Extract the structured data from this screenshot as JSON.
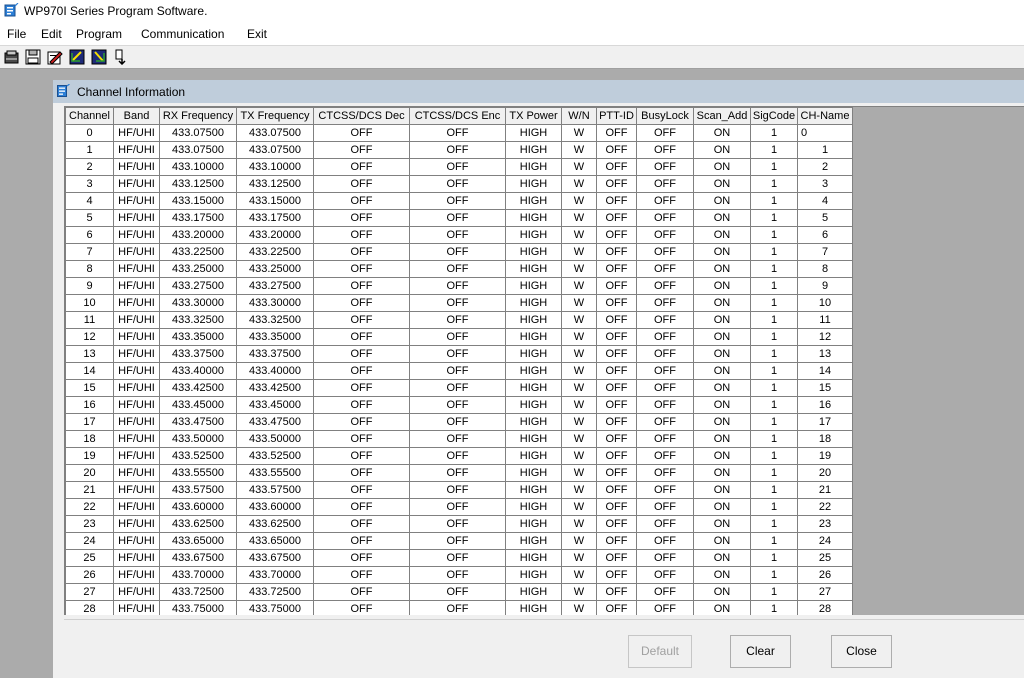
{
  "app": {
    "title": "WP970I Series Program Software."
  },
  "menu": [
    "File",
    "Edit",
    "Program",
    "Communication",
    "Exit"
  ],
  "toolbar": {
    "icons": [
      "open-icon",
      "save-icon",
      "edit-icon",
      "read-from-radio-icon",
      "write-to-radio-icon",
      "exit-icon"
    ]
  },
  "channel_window": {
    "title": "Channel Information",
    "columns": [
      "Channel",
      "Band",
      "RX Frequency",
      "TX Frequency",
      "CTCSS/DCS Dec",
      "CTCSS/DCS Enc",
      "TX Power",
      "W/N",
      "PTT-ID",
      "BusyLock",
      "Scan_Add",
      "SigCode",
      "CH-Name"
    ],
    "rows": [
      [
        "0",
        "HF/UHI",
        "433.07500",
        "433.07500",
        "OFF",
        "OFF",
        "HIGH",
        "W",
        "OFF",
        "OFF",
        "ON",
        "1",
        "0"
      ],
      [
        "1",
        "HF/UHI",
        "433.07500",
        "433.07500",
        "OFF",
        "OFF",
        "HIGH",
        "W",
        "OFF",
        "OFF",
        "ON",
        "1",
        "1"
      ],
      [
        "2",
        "HF/UHI",
        "433.10000",
        "433.10000",
        "OFF",
        "OFF",
        "HIGH",
        "W",
        "OFF",
        "OFF",
        "ON",
        "1",
        "2"
      ],
      [
        "3",
        "HF/UHI",
        "433.12500",
        "433.12500",
        "OFF",
        "OFF",
        "HIGH",
        "W",
        "OFF",
        "OFF",
        "ON",
        "1",
        "3"
      ],
      [
        "4",
        "HF/UHI",
        "433.15000",
        "433.15000",
        "OFF",
        "OFF",
        "HIGH",
        "W",
        "OFF",
        "OFF",
        "ON",
        "1",
        "4"
      ],
      [
        "5",
        "HF/UHI",
        "433.17500",
        "433.17500",
        "OFF",
        "OFF",
        "HIGH",
        "W",
        "OFF",
        "OFF",
        "ON",
        "1",
        "5"
      ],
      [
        "6",
        "HF/UHI",
        "433.20000",
        "433.20000",
        "OFF",
        "OFF",
        "HIGH",
        "W",
        "OFF",
        "OFF",
        "ON",
        "1",
        "6"
      ],
      [
        "7",
        "HF/UHI",
        "433.22500",
        "433.22500",
        "OFF",
        "OFF",
        "HIGH",
        "W",
        "OFF",
        "OFF",
        "ON",
        "1",
        "7"
      ],
      [
        "8",
        "HF/UHI",
        "433.25000",
        "433.25000",
        "OFF",
        "OFF",
        "HIGH",
        "W",
        "OFF",
        "OFF",
        "ON",
        "1",
        "8"
      ],
      [
        "9",
        "HF/UHI",
        "433.27500",
        "433.27500",
        "OFF",
        "OFF",
        "HIGH",
        "W",
        "OFF",
        "OFF",
        "ON",
        "1",
        "9"
      ],
      [
        "10",
        "HF/UHI",
        "433.30000",
        "433.30000",
        "OFF",
        "OFF",
        "HIGH",
        "W",
        "OFF",
        "OFF",
        "ON",
        "1",
        "10"
      ],
      [
        "11",
        "HF/UHI",
        "433.32500",
        "433.32500",
        "OFF",
        "OFF",
        "HIGH",
        "W",
        "OFF",
        "OFF",
        "ON",
        "1",
        "11"
      ],
      [
        "12",
        "HF/UHI",
        "433.35000",
        "433.35000",
        "OFF",
        "OFF",
        "HIGH",
        "W",
        "OFF",
        "OFF",
        "ON",
        "1",
        "12"
      ],
      [
        "13",
        "HF/UHI",
        "433.37500",
        "433.37500",
        "OFF",
        "OFF",
        "HIGH",
        "W",
        "OFF",
        "OFF",
        "ON",
        "1",
        "13"
      ],
      [
        "14",
        "HF/UHI",
        "433.40000",
        "433.40000",
        "OFF",
        "OFF",
        "HIGH",
        "W",
        "OFF",
        "OFF",
        "ON",
        "1",
        "14"
      ],
      [
        "15",
        "HF/UHI",
        "433.42500",
        "433.42500",
        "OFF",
        "OFF",
        "HIGH",
        "W",
        "OFF",
        "OFF",
        "ON",
        "1",
        "15"
      ],
      [
        "16",
        "HF/UHI",
        "433.45000",
        "433.45000",
        "OFF",
        "OFF",
        "HIGH",
        "W",
        "OFF",
        "OFF",
        "ON",
        "1",
        "16"
      ],
      [
        "17",
        "HF/UHI",
        "433.47500",
        "433.47500",
        "OFF",
        "OFF",
        "HIGH",
        "W",
        "OFF",
        "OFF",
        "ON",
        "1",
        "17"
      ],
      [
        "18",
        "HF/UHI",
        "433.50000",
        "433.50000",
        "OFF",
        "OFF",
        "HIGH",
        "W",
        "OFF",
        "OFF",
        "ON",
        "1",
        "18"
      ],
      [
        "19",
        "HF/UHI",
        "433.52500",
        "433.52500",
        "OFF",
        "OFF",
        "HIGH",
        "W",
        "OFF",
        "OFF",
        "ON",
        "1",
        "19"
      ],
      [
        "20",
        "HF/UHI",
        "433.55500",
        "433.55500",
        "OFF",
        "OFF",
        "HIGH",
        "W",
        "OFF",
        "OFF",
        "ON",
        "1",
        "20"
      ],
      [
        "21",
        "HF/UHI",
        "433.57500",
        "433.57500",
        "OFF",
        "OFF",
        "HIGH",
        "W",
        "OFF",
        "OFF",
        "ON",
        "1",
        "21"
      ],
      [
        "22",
        "HF/UHI",
        "433.60000",
        "433.60000",
        "OFF",
        "OFF",
        "HIGH",
        "W",
        "OFF",
        "OFF",
        "ON",
        "1",
        "22"
      ],
      [
        "23",
        "HF/UHI",
        "433.62500",
        "433.62500",
        "OFF",
        "OFF",
        "HIGH",
        "W",
        "OFF",
        "OFF",
        "ON",
        "1",
        "23"
      ],
      [
        "24",
        "HF/UHI",
        "433.65000",
        "433.65000",
        "OFF",
        "OFF",
        "HIGH",
        "W",
        "OFF",
        "OFF",
        "ON",
        "1",
        "24"
      ],
      [
        "25",
        "HF/UHI",
        "433.67500",
        "433.67500",
        "OFF",
        "OFF",
        "HIGH",
        "W",
        "OFF",
        "OFF",
        "ON",
        "1",
        "25"
      ],
      [
        "26",
        "HF/UHI",
        "433.70000",
        "433.70000",
        "OFF",
        "OFF",
        "HIGH",
        "W",
        "OFF",
        "OFF",
        "ON",
        "1",
        "26"
      ],
      [
        "27",
        "HF/UHI",
        "433.72500",
        "433.72500",
        "OFF",
        "OFF",
        "HIGH",
        "W",
        "OFF",
        "OFF",
        "ON",
        "1",
        "27"
      ],
      [
        "28",
        "HF/UHI",
        "433.75000",
        "433.75000",
        "OFF",
        "OFF",
        "HIGH",
        "W",
        "OFF",
        "OFF",
        "ON",
        "1",
        "28"
      ]
    ],
    "buttons": {
      "default_label": "Default",
      "clear_label": "Clear",
      "close_label": "Close"
    }
  },
  "colors": {
    "mdi_background": "#ababab",
    "child_titlebar": "#bfcddb",
    "grid_header": "#f0f0f0"
  }
}
